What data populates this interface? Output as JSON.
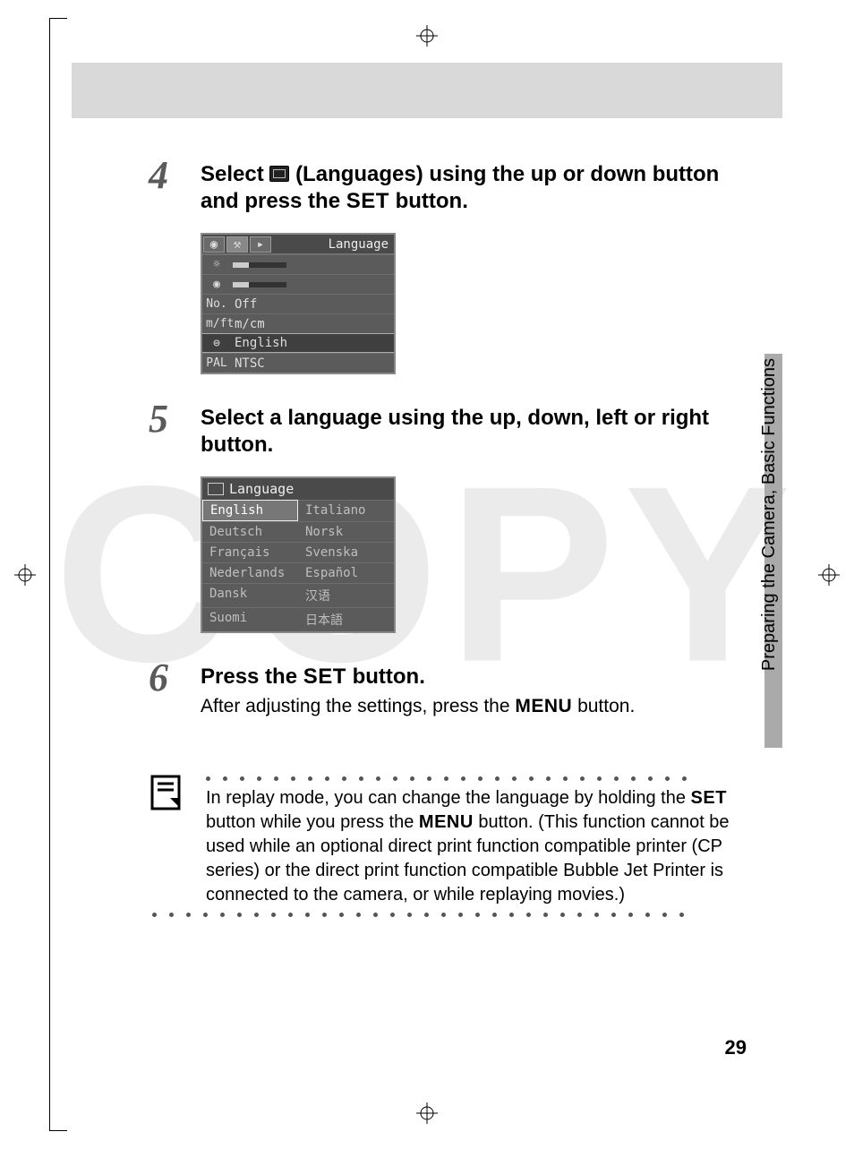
{
  "watermark": "COPY",
  "side_tab": "Preparing the Camera, Basic Functions",
  "page_number": "29",
  "steps": {
    "s4": {
      "num": "4",
      "title_pre": "Select ",
      "title_mid": " (Languages) using the up or down button and press the ",
      "set": "SET",
      "title_post": " button."
    },
    "s5": {
      "num": "5",
      "title": "Select a language using the up, down, left or right button."
    },
    "s6": {
      "num": "6",
      "title_pre": "Press the ",
      "set": "SET",
      "title_post": " button.",
      "body_pre": "After adjusting the settings, press the ",
      "menu": "MENU",
      "body_post": " button."
    }
  },
  "settings_menu": {
    "title": "Language",
    "rows": [
      {
        "icon": "☼",
        "value": ""
      },
      {
        "icon": "◉",
        "value": ""
      },
      {
        "icon": "No.",
        "value": "Off"
      },
      {
        "icon": "m/ft",
        "value": "m/cm"
      },
      {
        "icon": "⊜",
        "value": "English",
        "hl": true
      },
      {
        "icon": "PAL",
        "value": "NTSC"
      }
    ]
  },
  "lang_menu": {
    "title": "Language",
    "col1": [
      "English",
      "Deutsch",
      "Français",
      "Nederlands",
      "Dansk",
      "Suomi"
    ],
    "col2": [
      "Italiano",
      "Norsk",
      "Svenska",
      "Español",
      "汉语",
      "日本語"
    ]
  },
  "note": {
    "text_pre": "In replay mode, you can change the language by holding the ",
    "set": "SET",
    "text_mid": " button while you press the ",
    "menu": "MENU",
    "text_post": " button. (This function cannot be used while an optional direct print function compatible printer (CP series) or the direct print function compatible Bubble Jet Printer is connected to the camera, or while replaying movies.)"
  }
}
